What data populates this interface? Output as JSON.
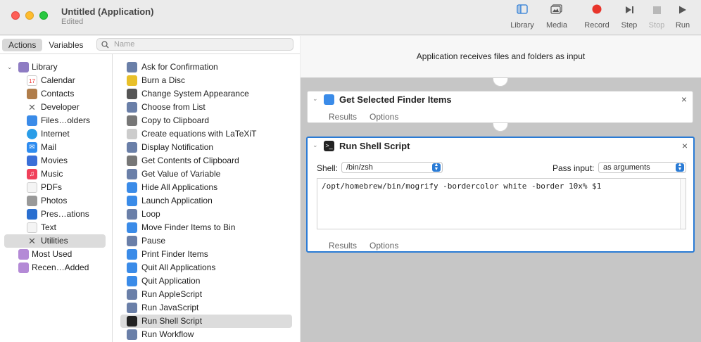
{
  "window": {
    "title": "Untitled (Application)",
    "subtitle": "Edited"
  },
  "toolbar": {
    "library": "Library",
    "media": "Media",
    "record": "Record",
    "step": "Step",
    "stop": "Stop",
    "run": "Run"
  },
  "tabs": {
    "actions": "Actions",
    "variables": "Variables"
  },
  "search": {
    "placeholder": "Name"
  },
  "library": {
    "root": "Library",
    "items": [
      "Calendar",
      "Contacts",
      "Developer",
      "Files…olders",
      "Internet",
      "Mail",
      "Movies",
      "Music",
      "PDFs",
      "Photos",
      "Pres…ations",
      "Text",
      "Utilities"
    ],
    "selected": "Utilities",
    "most_used": "Most Used",
    "recently_added": "Recen…Added"
  },
  "actions": [
    "Ask for Confirmation",
    "Burn a Disc",
    "Change System Appearance",
    "Choose from List",
    "Copy to Clipboard",
    "Create equations with LaTeXiT",
    "Display Notification",
    "Get Contents of Clipboard",
    "Get Value of Variable",
    "Hide All Applications",
    "Launch Application",
    "Loop",
    "Move Finder Items to Bin",
    "Pause",
    "Print Finder Items",
    "Quit All Applications",
    "Quit Application",
    "Run AppleScript",
    "Run JavaScript",
    "Run Shell Script",
    "Run Workflow"
  ],
  "selected_action": "Run Shell Script",
  "workflow": {
    "header": "Application receives files and folders as input",
    "action1": {
      "title": "Get Selected Finder Items",
      "results": "Results",
      "options": "Options"
    },
    "action2": {
      "title": "Run Shell Script",
      "shell_label": "Shell:",
      "shell_value": "/bin/zsh",
      "pass_label": "Pass input:",
      "pass_value": "as arguments",
      "script": "/opt/homebrew/bin/mogrify -bordercolor white -border 10x% $1",
      "results": "Results",
      "options": "Options"
    },
    "close_glyph": "×"
  },
  "colors": {
    "accent": "#2a7bd5",
    "record": "#e8352b"
  }
}
